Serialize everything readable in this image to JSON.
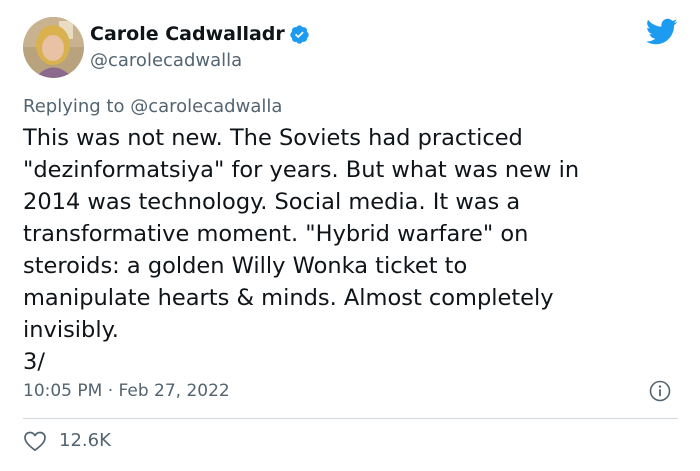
{
  "author": {
    "name": "Carole Cadwalladr",
    "handle": "@carolecadwalla"
  },
  "reply": {
    "prefix": "Replying to",
    "to": "@carolecadwalla"
  },
  "tweet": {
    "text": "This was not new. The Soviets had practiced\n\"dezinformatsiya\" for years. But what was new in\n2014 was technology. Social media. It was a\ntransformative moment. \"Hybrid warfare\" on\nsteroids: a golden Willy Wonka ticket to\nmanipulate hearts & minds. Almost completely\ninvisibly.\n3/"
  },
  "meta": {
    "time": "10:05 PM",
    "separator": "·",
    "date": "Feb 27, 2022"
  },
  "engagement": {
    "likes": "12.6K"
  },
  "colors": {
    "twitter_blue": "#1d9bf0",
    "secondary_text": "#536471",
    "primary_text": "#0f1419"
  }
}
